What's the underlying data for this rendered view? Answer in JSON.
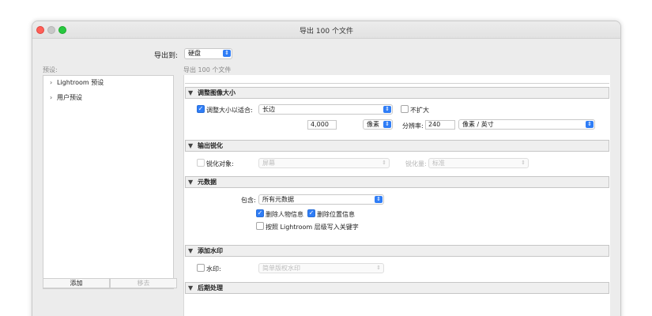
{
  "window": {
    "title": "导出 100 个文件"
  },
  "export_to": {
    "label": "导出到:",
    "value": "硬盘"
  },
  "presets": {
    "label": "预设:",
    "items": [
      {
        "label": "Lightroom 预设"
      },
      {
        "label": "用户预设"
      }
    ],
    "add_label": "添加",
    "remove_label": "移去"
  },
  "export_summary": "导出 100 个文件",
  "sections": {
    "resize": {
      "title": "调整图像大小",
      "fit_label": "调整大小以适合:",
      "fit_value": "长边",
      "no_enlarge_label": "不扩大",
      "size_value": "4,000",
      "size_unit": "像素",
      "resolution_label": "分辨率:",
      "resolution_value": "240",
      "resolution_unit": "像素 / 英寸"
    },
    "sharpen": {
      "title": "输出锐化",
      "sharpen_for_label": "锐化对象:",
      "sharpen_for_value": "屏幕",
      "amount_label": "锐化量:",
      "amount_value": "标准"
    },
    "metadata": {
      "title": "元数据",
      "include_label": "包含:",
      "include_value": "所有元数据",
      "remove_person_label": "删除人物信息",
      "remove_location_label": "删除位置信息",
      "hierarchy_label": "按照 Lightroom 层级写入关键字"
    },
    "watermark": {
      "title": "添加水印",
      "watermark_label": "水印:",
      "watermark_value": "简单版权水印"
    },
    "post": {
      "title": "后期处理"
    }
  }
}
